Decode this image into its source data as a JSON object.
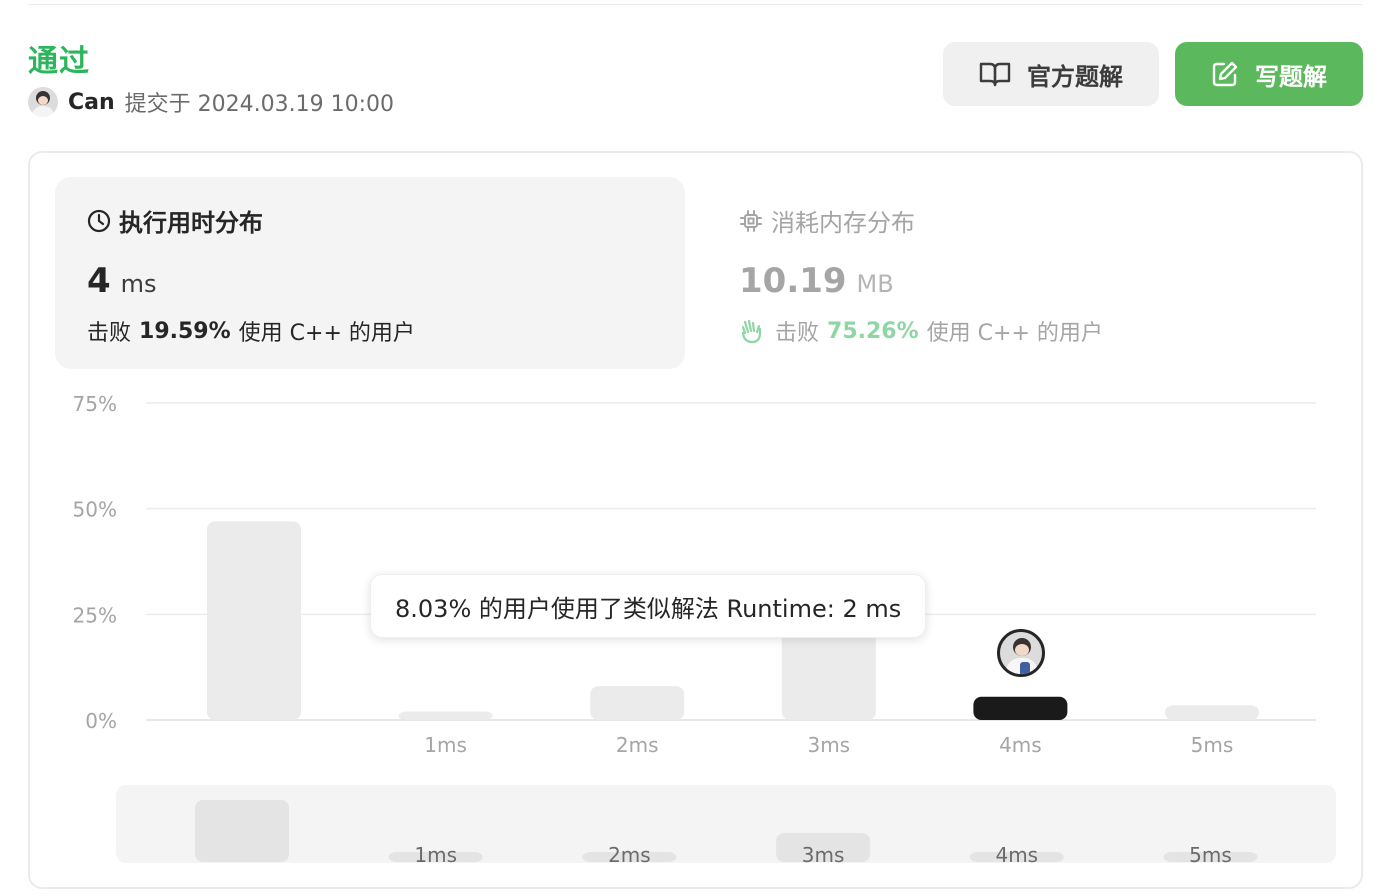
{
  "header": {
    "status": "通过",
    "user": "Can",
    "submitted": "提交于 2024.03.19 10:00",
    "official_solution": "官方题解",
    "write_solution": "写题解",
    "colors": {
      "accepted": "#2db55d",
      "primary_button": "#5cb85c"
    }
  },
  "runtime": {
    "title": "执行用时分布",
    "value": "4",
    "unit": "ms",
    "beats_prefix": "击败",
    "beats_percent": "19.59%",
    "beats_suffix": "使用 C++ 的用户"
  },
  "memory": {
    "title": "消耗内存分布",
    "value": "10.19",
    "unit": "MB",
    "beats_prefix": "击败",
    "beats_percent": "75.26%",
    "beats_suffix": "使用 C++ 的用户"
  },
  "tooltip": "8.03% 的用户使用了类似解法 Runtime: 2 ms",
  "chart_data": {
    "type": "bar",
    "categories": [
      "",
      "1ms",
      "2ms",
      "3ms",
      "4ms",
      "5ms"
    ],
    "values": [
      47,
      2,
      8,
      22,
      5.5,
      3.5
    ],
    "y_ticks": [
      "0%",
      "25%",
      "50%",
      "75%"
    ],
    "ylim": [
      0,
      75
    ],
    "highlight_index": 4,
    "highlight_color": "#1a1a1a",
    "bar_color": "#ebebeb",
    "grid": true,
    "overview": {
      "categories": [
        "",
        "1ms",
        "2ms",
        "3ms",
        "4ms",
        "5ms"
      ],
      "values": [
        47,
        2,
        2,
        22,
        2,
        2
      ]
    }
  }
}
